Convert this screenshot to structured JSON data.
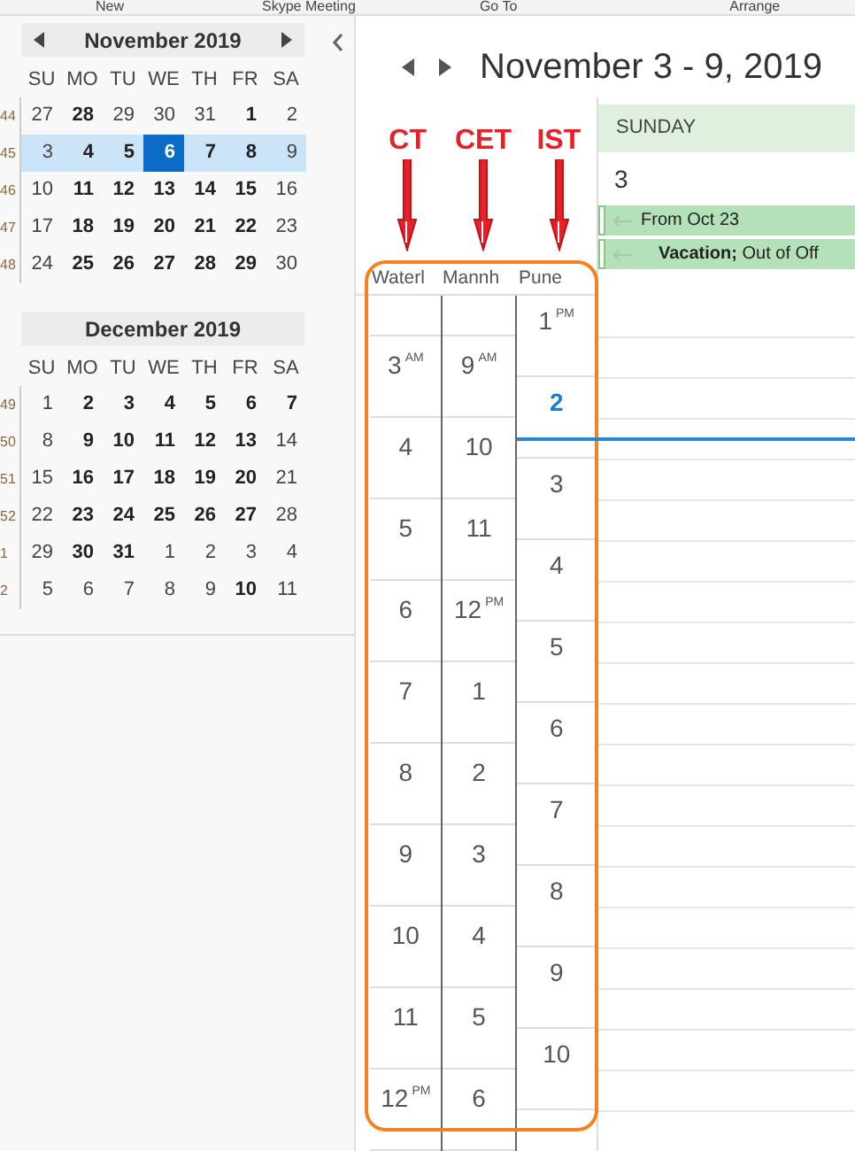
{
  "ribbon": [
    {
      "label": "New"
    },
    {
      "label": "Skype Meeting"
    },
    {
      "label": "Go To"
    },
    {
      "label": "Arrange"
    }
  ],
  "mini_calendars": [
    {
      "title": "November 2019",
      "nav": true,
      "weekdays": [
        "SU",
        "MO",
        "TU",
        "WE",
        "TH",
        "FR",
        "SA"
      ],
      "weeks": [
        {
          "number": "44",
          "selected": false,
          "days": [
            {
              "d": "27",
              "bold": false,
              "selected": false
            },
            {
              "d": "28",
              "bold": true,
              "selected": false
            },
            {
              "d": "29",
              "bold": false,
              "selected": false
            },
            {
              "d": "30",
              "bold": false,
              "selected": false
            },
            {
              "d": "31",
              "bold": false,
              "selected": false
            },
            {
              "d": "1",
              "bold": true,
              "selected": false
            },
            {
              "d": "2",
              "bold": false,
              "selected": false
            }
          ]
        },
        {
          "number": "45",
          "selected": true,
          "days": [
            {
              "d": "3",
              "bold": false,
              "selected": false
            },
            {
              "d": "4",
              "bold": true,
              "selected": false
            },
            {
              "d": "5",
              "bold": true,
              "selected": false
            },
            {
              "d": "6",
              "bold": true,
              "selected": true
            },
            {
              "d": "7",
              "bold": true,
              "selected": false
            },
            {
              "d": "8",
              "bold": true,
              "selected": false
            },
            {
              "d": "9",
              "bold": false,
              "selected": false
            }
          ]
        },
        {
          "number": "46",
          "selected": false,
          "days": [
            {
              "d": "10",
              "bold": false,
              "selected": false
            },
            {
              "d": "11",
              "bold": true,
              "selected": false
            },
            {
              "d": "12",
              "bold": true,
              "selected": false
            },
            {
              "d": "13",
              "bold": true,
              "selected": false
            },
            {
              "d": "14",
              "bold": true,
              "selected": false
            },
            {
              "d": "15",
              "bold": true,
              "selected": false
            },
            {
              "d": "16",
              "bold": false,
              "selected": false
            }
          ]
        },
        {
          "number": "47",
          "selected": false,
          "days": [
            {
              "d": "17",
              "bold": false,
              "selected": false
            },
            {
              "d": "18",
              "bold": true,
              "selected": false
            },
            {
              "d": "19",
              "bold": true,
              "selected": false
            },
            {
              "d": "20",
              "bold": true,
              "selected": false
            },
            {
              "d": "21",
              "bold": true,
              "selected": false
            },
            {
              "d": "22",
              "bold": true,
              "selected": false
            },
            {
              "d": "23",
              "bold": false,
              "selected": false
            }
          ]
        },
        {
          "number": "48",
          "selected": false,
          "days": [
            {
              "d": "24",
              "bold": false,
              "selected": false
            },
            {
              "d": "25",
              "bold": true,
              "selected": false
            },
            {
              "d": "26",
              "bold": true,
              "selected": false
            },
            {
              "d": "27",
              "bold": true,
              "selected": false
            },
            {
              "d": "28",
              "bold": true,
              "selected": false
            },
            {
              "d": "29",
              "bold": true,
              "selected": false
            },
            {
              "d": "30",
              "bold": false,
              "selected": false
            }
          ]
        }
      ]
    },
    {
      "title": "December 2019",
      "nav": false,
      "weekdays": [
        "SU",
        "MO",
        "TU",
        "WE",
        "TH",
        "FR",
        "SA"
      ],
      "weeks": [
        {
          "number": "49",
          "selected": false,
          "days": [
            {
              "d": "1",
              "bold": false,
              "selected": false
            },
            {
              "d": "2",
              "bold": true,
              "selected": false
            },
            {
              "d": "3",
              "bold": true,
              "selected": false
            },
            {
              "d": "4",
              "bold": true,
              "selected": false
            },
            {
              "d": "5",
              "bold": true,
              "selected": false
            },
            {
              "d": "6",
              "bold": true,
              "selected": false
            },
            {
              "d": "7",
              "bold": true,
              "selected": false
            }
          ]
        },
        {
          "number": "50",
          "selected": false,
          "days": [
            {
              "d": "8",
              "bold": false,
              "selected": false
            },
            {
              "d": "9",
              "bold": true,
              "selected": false
            },
            {
              "d": "10",
              "bold": true,
              "selected": false
            },
            {
              "d": "11",
              "bold": true,
              "selected": false
            },
            {
              "d": "12",
              "bold": true,
              "selected": false
            },
            {
              "d": "13",
              "bold": true,
              "selected": false
            },
            {
              "d": "14",
              "bold": false,
              "selected": false
            }
          ]
        },
        {
          "number": "51",
          "selected": false,
          "days": [
            {
              "d": "15",
              "bold": false,
              "selected": false
            },
            {
              "d": "16",
              "bold": true,
              "selected": false
            },
            {
              "d": "17",
              "bold": true,
              "selected": false
            },
            {
              "d": "18",
              "bold": true,
              "selected": false
            },
            {
              "d": "19",
              "bold": true,
              "selected": false
            },
            {
              "d": "20",
              "bold": true,
              "selected": false
            },
            {
              "d": "21",
              "bold": false,
              "selected": false
            }
          ]
        },
        {
          "number": "52",
          "selected": false,
          "days": [
            {
              "d": "22",
              "bold": false,
              "selected": false
            },
            {
              "d": "23",
              "bold": true,
              "selected": false
            },
            {
              "d": "24",
              "bold": true,
              "selected": false
            },
            {
              "d": "25",
              "bold": true,
              "selected": false
            },
            {
              "d": "26",
              "bold": true,
              "selected": false
            },
            {
              "d": "27",
              "bold": true,
              "selected": false
            },
            {
              "d": "28",
              "bold": false,
              "selected": false
            }
          ]
        },
        {
          "number": "1",
          "selected": false,
          "days": [
            {
              "d": "29",
              "bold": false,
              "selected": false
            },
            {
              "d": "30",
              "bold": true,
              "selected": false
            },
            {
              "d": "31",
              "bold": true,
              "selected": false
            },
            {
              "d": "1",
              "bold": false,
              "selected": false
            },
            {
              "d": "2",
              "bold": false,
              "selected": false
            },
            {
              "d": "3",
              "bold": false,
              "selected": false
            },
            {
              "d": "4",
              "bold": false,
              "selected": false
            }
          ]
        },
        {
          "number": "2",
          "selected": false,
          "days": [
            {
              "d": "5",
              "bold": false,
              "selected": false
            },
            {
              "d": "6",
              "bold": false,
              "selected": false
            },
            {
              "d": "7",
              "bold": false,
              "selected": false
            },
            {
              "d": "8",
              "bold": false,
              "selected": false
            },
            {
              "d": "9",
              "bold": false,
              "selected": false
            },
            {
              "d": "10",
              "bold": true,
              "selected": false
            },
            {
              "d": "11",
              "bold": false,
              "selected": false
            }
          ]
        }
      ]
    }
  ],
  "calendar": {
    "title": "November 3 - 9, 2019",
    "time_zones": [
      {
        "name": "Waterl",
        "annotation": "CT",
        "slots": [
          {
            "hour": "3",
            "suffix": "AM",
            "current": false
          },
          {
            "hour": "4",
            "current": false
          },
          {
            "hour": "5",
            "current": false
          },
          {
            "hour": "6",
            "current": false
          },
          {
            "hour": "7",
            "current": false
          },
          {
            "hour": "8",
            "current": false
          },
          {
            "hour": "9",
            "current": false
          },
          {
            "hour": "10",
            "current": false
          },
          {
            "hour": "11",
            "current": false
          },
          {
            "hour": "12",
            "suffix": "PM",
            "current": false
          }
        ]
      },
      {
        "name": "Mannh",
        "annotation": "CET",
        "slots": [
          {
            "hour": "9",
            "suffix": "AM",
            "current": false
          },
          {
            "hour": "10",
            "current": false
          },
          {
            "hour": "11",
            "current": false
          },
          {
            "hour": "12",
            "suffix": "PM",
            "current": false
          },
          {
            "hour": "1",
            "current": false
          },
          {
            "hour": "2",
            "current": false
          },
          {
            "hour": "3",
            "current": false
          },
          {
            "hour": "4",
            "current": false
          },
          {
            "hour": "5",
            "current": false
          },
          {
            "hour": "6",
            "current": false
          }
        ]
      },
      {
        "name": "Pune",
        "annotation": "IST",
        "slots": [
          {
            "hour": "1",
            "suffix": "PM",
            "current": false
          },
          {
            "hour": "2",
            "current": true
          },
          {
            "hour": "3",
            "current": false
          },
          {
            "hour": "4",
            "current": false
          },
          {
            "hour": "5",
            "current": false
          },
          {
            "hour": "6",
            "current": false
          },
          {
            "hour": "7",
            "current": false
          },
          {
            "hour": "8",
            "current": false
          },
          {
            "hour": "9",
            "current": false
          },
          {
            "hour": "10",
            "current": false
          }
        ]
      }
    ],
    "day": {
      "weekday": "SUNDAY",
      "date": "3",
      "events": [
        {
          "text": "From Oct 23",
          "continued": true
        },
        {
          "text": "**Vacation;** Out of Off",
          "continued": true
        }
      ]
    }
  }
}
